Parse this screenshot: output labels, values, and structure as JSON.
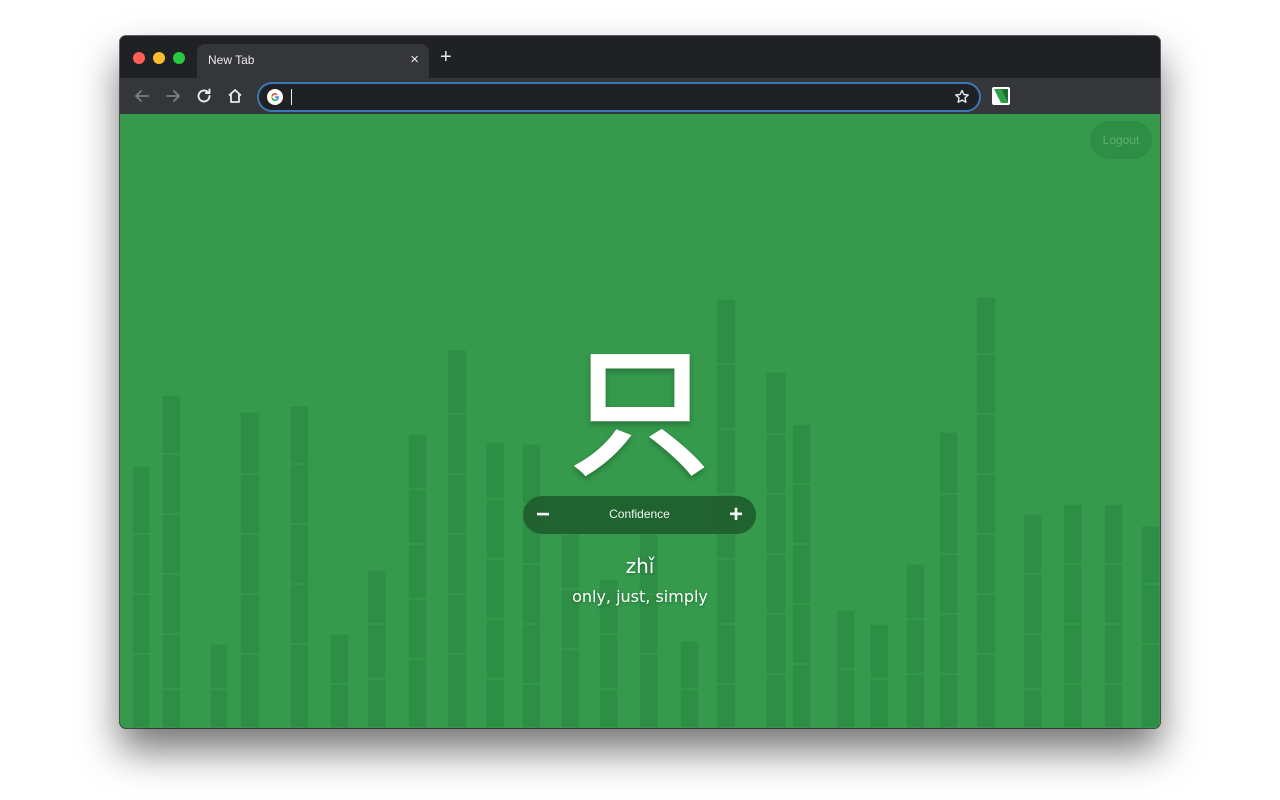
{
  "browser": {
    "tab": {
      "title": "New Tab",
      "close_glyph": "×"
    },
    "new_tab_glyph": "+",
    "omnibox": {
      "value": "",
      "placeholder": ""
    },
    "icons": [
      "back-icon",
      "forward-icon",
      "reload-icon",
      "home-icon",
      "google-icon",
      "star-icon",
      "extension-icon"
    ]
  },
  "page": {
    "logout_label": "Logout",
    "character": "只",
    "pinyin": "zhǐ",
    "meaning": "only, just, simply",
    "confidence": {
      "minus": "−",
      "label": "Confidence",
      "plus": "+"
    }
  },
  "colors": {
    "background_green": "#359a4c",
    "bamboo": "#2e8e45",
    "confidence_bar": "#1f5e2e",
    "chrome_dark": "#202124",
    "chrome_toolbar": "#35363a"
  }
}
